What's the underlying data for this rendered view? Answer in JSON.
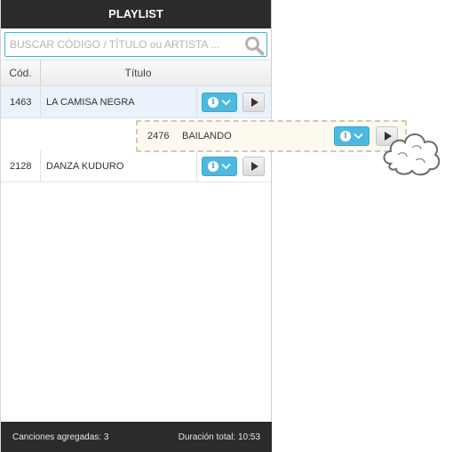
{
  "header": {
    "title": "PLAYLIST"
  },
  "search": {
    "placeholder": "BUSCAR CÓDIGO / TÍTULO ou ARTISTA ...",
    "value": "",
    "icon": "search-icon"
  },
  "table": {
    "columns": {
      "code": "Cód.",
      "title": "Título"
    },
    "rows": [
      {
        "code": "1463",
        "title": "LA CAMISA NEGRA"
      },
      {
        "code": "2128",
        "title": "DANZA KUDURO"
      }
    ]
  },
  "dragging": {
    "code": "2476",
    "title": "BAILANDO"
  },
  "footer": {
    "added": "Canciones agregadas: 3",
    "duration": "Duración total: 10:53"
  },
  "colors": {
    "header_bg": "#2b2b2b",
    "accent": "#4cb9e0",
    "selected_row": "#eaf3fb",
    "drag_bg": "#fdf9ee"
  }
}
